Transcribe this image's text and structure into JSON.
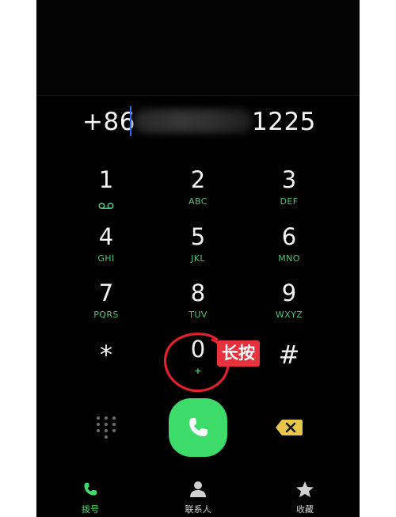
{
  "number": {
    "prefix": "+86",
    "suffix": "1225"
  },
  "keypad": [
    {
      "digit": "1",
      "letters": "",
      "icon": "voicemail-icon"
    },
    {
      "digit": "2",
      "letters": "ABC"
    },
    {
      "digit": "3",
      "letters": "DEF"
    },
    {
      "digit": "4",
      "letters": "GHI"
    },
    {
      "digit": "5",
      "letters": "JKL"
    },
    {
      "digit": "6",
      "letters": "MNO"
    },
    {
      "digit": "7",
      "letters": "PQRS"
    },
    {
      "digit": "8",
      "letters": "TUV"
    },
    {
      "digit": "9",
      "letters": "WXYZ"
    },
    {
      "digit": "*",
      "letters": ""
    },
    {
      "digit": "0",
      "letters": "+"
    },
    {
      "digit": "#",
      "letters": ""
    }
  ],
  "annotation": {
    "label": "长按",
    "circle_color": "#e0202c"
  },
  "actions": {
    "dots_icon": "dialpad-dots-icon",
    "call_icon": "phone-icon",
    "backspace_icon": "backspace-icon"
  },
  "tabs": [
    {
      "label": "拨号",
      "icon": "phone-icon",
      "active": true
    },
    {
      "label": "联系人",
      "icon": "person-icon",
      "active": false
    },
    {
      "label": "收藏",
      "icon": "star-icon",
      "active": false
    }
  ],
  "colors": {
    "accent": "#3ddc6a",
    "letters": "#4fc37a",
    "background": "#000000",
    "backspace": "#e8c64a",
    "annotation": "#e5323c"
  }
}
